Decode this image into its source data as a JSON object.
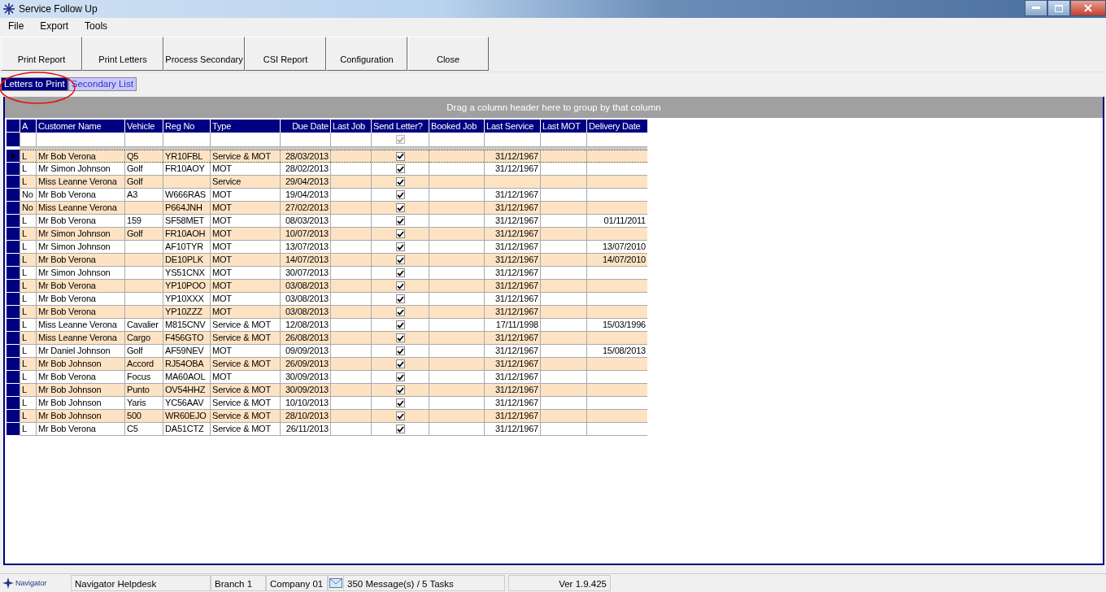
{
  "window": {
    "title": "Service Follow Up"
  },
  "menu": [
    "File",
    "Export",
    "Tools"
  ],
  "toolbar": [
    "Print Report",
    "Print Letters",
    "Process Secondary",
    "CSI Report",
    "Configuration",
    "Close"
  ],
  "tabs": [
    {
      "label": "Letters to Print",
      "selected": true
    },
    {
      "label": "Secondary List",
      "selected": false
    }
  ],
  "annotation": {
    "kind": "ellipse"
  },
  "group_panel": {
    "hint": "Drag a column header here to group by that column"
  },
  "table": {
    "columns": [
      {
        "label": "A",
        "kind": "text"
      },
      {
        "label": "Customer Name",
        "kind": "text"
      },
      {
        "label": "Vehicle",
        "kind": "text"
      },
      {
        "label": "Reg No",
        "kind": "text"
      },
      {
        "label": "Type",
        "kind": "text"
      },
      {
        "label": "Due Date",
        "kind": "date"
      },
      {
        "label": "Last Job",
        "kind": "text"
      },
      {
        "label": "Send Letter?",
        "kind": "check"
      },
      {
        "label": "Booked Job",
        "kind": "text"
      },
      {
        "label": "Last Service",
        "kind": "date"
      },
      {
        "label": "Last MOT",
        "kind": "date"
      },
      {
        "label": "Delivery Date",
        "kind": "date"
      }
    ],
    "filter_checked": true,
    "rows": [
      {
        "selected": true,
        "cells": [
          "L",
          "Mr Bob Verona",
          "Q5",
          "YR10FBL",
          "Service  & MOT",
          "28/03/2013",
          null,
          true,
          null,
          "31/12/1967",
          null,
          null
        ]
      },
      {
        "selected": false,
        "cells": [
          "L",
          "Mr Simon Johnson",
          "Golf",
          "FR10AOY",
          "MOT",
          "28/02/2013",
          null,
          true,
          null,
          "31/12/1967",
          null,
          null
        ]
      },
      {
        "selected": false,
        "cells": [
          "L",
          "Miss Leanne Verona",
          "Golf",
          null,
          "Service",
          "29/04/2013",
          null,
          true,
          null,
          null,
          null,
          null
        ]
      },
      {
        "selected": false,
        "cells": [
          "No",
          "Mr Bob Verona",
          "A3",
          "W666RAS",
          "MOT",
          "19/04/2013",
          null,
          true,
          null,
          "31/12/1967",
          null,
          null
        ]
      },
      {
        "selected": false,
        "cells": [
          "No",
          "Miss Leanne Verona",
          null,
          "P664JNH",
          "MOT",
          "27/02/2013",
          null,
          true,
          null,
          "31/12/1967",
          null,
          null
        ]
      },
      {
        "selected": false,
        "cells": [
          "L",
          "Mr Bob Verona",
          "159",
          "SF58MET",
          "MOT",
          "08/03/2013",
          null,
          true,
          null,
          "31/12/1967",
          null,
          "01/11/2011"
        ]
      },
      {
        "selected": false,
        "cells": [
          "L",
          "Mr Simon Johnson",
          "Golf",
          "FR10AOH",
          "MOT",
          "10/07/2013",
          null,
          true,
          null,
          "31/12/1967",
          null,
          null
        ]
      },
      {
        "selected": false,
        "cells": [
          "L",
          "Mr Simon Johnson",
          null,
          "AF10TYR",
          "MOT",
          "13/07/2013",
          null,
          true,
          null,
          "31/12/1967",
          null,
          "13/07/2010"
        ]
      },
      {
        "selected": false,
        "cells": [
          "L",
          "Mr Bob Verona",
          null,
          "DE10PLK",
          "MOT",
          "14/07/2013",
          null,
          true,
          null,
          "31/12/1967",
          null,
          "14/07/2010"
        ]
      },
      {
        "selected": false,
        "cells": [
          "L",
          "Mr Simon Johnson",
          null,
          "YS51CNX",
          "MOT",
          "30/07/2013",
          null,
          true,
          null,
          "31/12/1967",
          null,
          null
        ]
      },
      {
        "selected": false,
        "cells": [
          "L",
          "Mr Bob Verona",
          null,
          "YP10POO",
          "MOT",
          "03/08/2013",
          null,
          true,
          null,
          "31/12/1967",
          null,
          null
        ]
      },
      {
        "selected": false,
        "cells": [
          "L",
          "Mr Bob Verona",
          null,
          "YP10XXX",
          "MOT",
          "03/08/2013",
          null,
          true,
          null,
          "31/12/1967",
          null,
          null
        ]
      },
      {
        "selected": false,
        "cells": [
          "L",
          "Mr Bob Verona",
          null,
          "YP10ZZZ",
          "MOT",
          "03/08/2013",
          null,
          true,
          null,
          "31/12/1967",
          null,
          null
        ]
      },
      {
        "selected": false,
        "cells": [
          "L",
          "Miss Leanne Verona",
          "Cavalier",
          "M815CNV",
          "Service  & MOT",
          "12/08/2013",
          null,
          true,
          null,
          "17/11/1998",
          null,
          "15/03/1996"
        ]
      },
      {
        "selected": false,
        "cells": [
          "L",
          "Miss Leanne Verona",
          "Cargo",
          "F456GTO",
          "Service  & MOT",
          "26/08/2013",
          null,
          true,
          null,
          "31/12/1967",
          null,
          null
        ]
      },
      {
        "selected": false,
        "cells": [
          "L",
          "Mr Daniel Johnson",
          "Golf",
          "AF59NEV",
          "MOT",
          "09/09/2013",
          null,
          true,
          null,
          "31/12/1967",
          null,
          "15/08/2013"
        ]
      },
      {
        "selected": false,
        "cells": [
          "L",
          "Mr Bob Johnson",
          "Accord",
          "RJ54OBA",
          "Service  & MOT",
          "26/09/2013",
          null,
          true,
          null,
          "31/12/1967",
          null,
          null
        ]
      },
      {
        "selected": false,
        "cells": [
          "L",
          "Mr Bob Verona",
          "Focus",
          "MA60AOL",
          "MOT",
          "30/09/2013",
          null,
          true,
          null,
          "31/12/1967",
          null,
          null
        ]
      },
      {
        "selected": false,
        "cells": [
          "L",
          "Mr Bob Johnson",
          "Punto",
          "OV54HHZ",
          "Service  & MOT",
          "30/09/2013",
          null,
          true,
          null,
          "31/12/1967",
          null,
          null
        ]
      },
      {
        "selected": false,
        "cells": [
          "L",
          "Mr Bob Johnson",
          "Yaris",
          "YC56AAV",
          "Service  & MOT",
          "10/10/2013",
          null,
          true,
          null,
          "31/12/1967",
          null,
          null
        ]
      },
      {
        "selected": false,
        "cells": [
          "L",
          "Mr Bob Johnson",
          "500",
          "WR60EJO",
          "Service  & MOT",
          "28/10/2013",
          null,
          true,
          null,
          "31/12/1967",
          null,
          null
        ]
      },
      {
        "selected": false,
        "cells": [
          "L",
          "Mr Bob Verona",
          "C5",
          "DA51CTZ",
          "Service  & MOT",
          "26/11/2013",
          null,
          true,
          null,
          "31/12/1967",
          null,
          null
        ]
      }
    ]
  },
  "status_bar": {
    "logo": "Navigator",
    "panels": [
      "Navigator Helpdesk",
      "Branch 1",
      "Company 01",
      "350 Message(s) / 5 Tasks",
      "Ver 1.9.425"
    ]
  }
}
